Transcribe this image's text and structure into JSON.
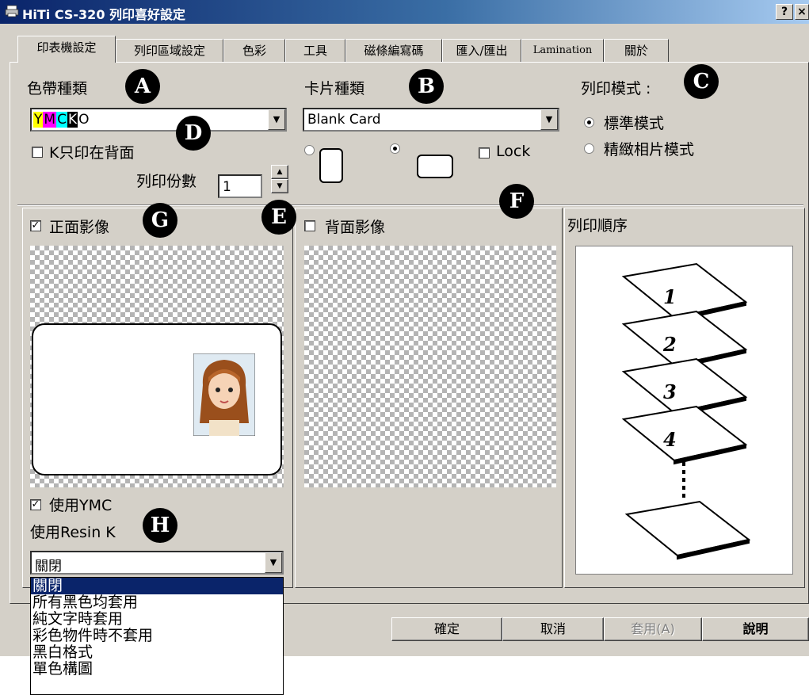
{
  "window": {
    "title": "HiTi CS-320 列印喜好設定",
    "help_button": "?",
    "close_button": "×"
  },
  "tabs": [
    "印表機設定",
    "列印區域設定",
    "色彩",
    "工具",
    "磁條編寫碼",
    "匯入/匯出",
    "Lamination",
    "關於"
  ],
  "ribbon": {
    "label": "色帶種類",
    "selected_parts": [
      {
        "text": "Y",
        "bg": "#ffff00",
        "fg": "#000000"
      },
      {
        "text": "M",
        "bg": "#ff00ff",
        "fg": "#000000"
      },
      {
        "text": "C",
        "bg": "#00ffff",
        "fg": "#000000"
      },
      {
        "text": "K",
        "bg": "#000000",
        "fg": "#ffffff"
      },
      {
        "text": "O",
        "bg": "#ffffff",
        "fg": "#000000"
      }
    ],
    "k_back_only_label": "K只印在背面",
    "k_back_only_checked": false
  },
  "copies": {
    "label": "列印份數",
    "value": "1"
  },
  "card": {
    "label": "卡片種類",
    "selected": "Blank Card",
    "orientation_portrait_selected": false,
    "orientation_landscape_selected": true,
    "lock_label": "Lock",
    "lock_checked": false
  },
  "print_mode": {
    "label": "列印模式 :",
    "options": [
      {
        "label": "標準模式",
        "selected": true
      },
      {
        "label": "精緻相片模式",
        "selected": false
      }
    ]
  },
  "front": {
    "label": "正面影像",
    "checked": true
  },
  "back": {
    "label": "背面影像",
    "checked": false
  },
  "use_ymc": {
    "label": "使用YMC",
    "checked": true
  },
  "resin_k": {
    "label": "使用Resin K",
    "selected": "關閉",
    "options": [
      "關閉",
      "所有黑色均套用",
      "純文字時套用",
      "彩色物件時不套用",
      "黑白格式",
      "單色構圖"
    ]
  },
  "print_order": {
    "label": "列印順序",
    "steps": [
      "1",
      "2",
      "3",
      "4"
    ]
  },
  "buttons": {
    "ok": "確定",
    "cancel": "取消",
    "apply": "套用(A)",
    "help": "說明"
  },
  "markers": [
    "A",
    "B",
    "C",
    "D",
    "E",
    "F",
    "G",
    "H"
  ]
}
